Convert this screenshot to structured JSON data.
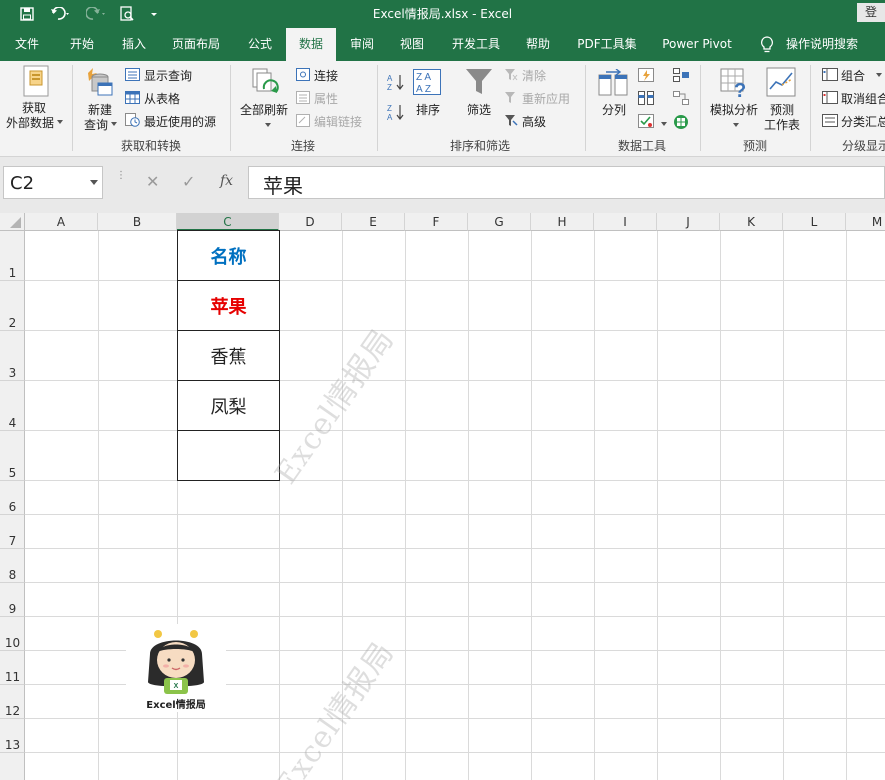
{
  "titlebar": {
    "title": "Excel情报局.xlsx  -  Excel",
    "login": "登"
  },
  "tabs": [
    {
      "label": "文件"
    },
    {
      "label": "开始"
    },
    {
      "label": "插入"
    },
    {
      "label": "页面布局"
    },
    {
      "label": "公式"
    },
    {
      "label": "数据"
    },
    {
      "label": "审阅"
    },
    {
      "label": "视图"
    },
    {
      "label": "开发工具"
    },
    {
      "label": "帮助"
    },
    {
      "label": "PDF工具集"
    },
    {
      "label": "Power Pivot"
    },
    {
      "label": "操作说明搜索"
    }
  ],
  "active_tab": "数据",
  "ribbon": {
    "get_external_line1": "获取",
    "get_external_line2": "外部数据",
    "new_query_line1": "新建",
    "new_query_line2": "查询",
    "show_queries": "显示查询",
    "from_table": "从表格",
    "recent_sources": "最近使用的源",
    "group_get_transform": "获取和转换",
    "refresh_all": "全部刷新",
    "connections": "连接",
    "properties": "属性",
    "edit_links": "编辑链接",
    "group_connections": "连接",
    "sort": "排序",
    "filter": "筛选",
    "clear": "清除",
    "reapply": "重新应用",
    "advanced": "高级",
    "group_sort_filter": "排序和筛选",
    "text_to_columns": "分列",
    "group_data_tools": "数据工具",
    "what_if": "模拟分析",
    "forecast_line1": "预测",
    "forecast_line2": "工作表",
    "group_forecast": "预测",
    "group_btn": "组合",
    "ungroup": "取消组合",
    "subtotal": "分类汇总",
    "group_outline": "分级显示"
  },
  "formula_bar": {
    "name_box": "C2",
    "formula": "苹果",
    "cancel_glyph": "✕",
    "enter_glyph": "✓",
    "fx_glyph": "fx"
  },
  "columns": [
    "A",
    "B",
    "C",
    "D",
    "E",
    "F",
    "G",
    "H",
    "I",
    "J",
    "K",
    "L",
    "M"
  ],
  "rows": [
    "1",
    "2",
    "3",
    "4",
    "5",
    "6",
    "7",
    "8",
    "9",
    "10",
    "11",
    "12",
    "13"
  ],
  "cells": {
    "C1": "名称",
    "C2": "苹果",
    "C3": "香蕉",
    "C4": "凤梨",
    "C5": ""
  },
  "colors": {
    "brand": "#217346",
    "header_blue": "#0070c0",
    "selected_red": "#e60000"
  },
  "watermark": "Excel情报局",
  "logo_text": "Excel情报局"
}
